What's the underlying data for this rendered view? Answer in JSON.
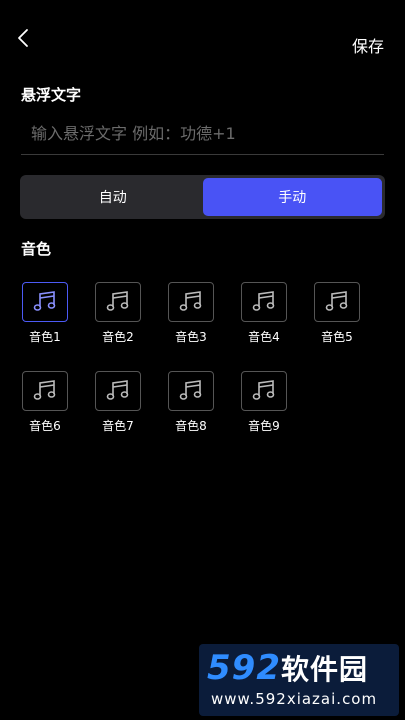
{
  "header": {
    "save_label": "保存"
  },
  "float_text": {
    "title": "悬浮文字",
    "placeholder": "输入悬浮文字 例如：功德+1",
    "value": ""
  },
  "mode": {
    "options": [
      "自动",
      "手动"
    ],
    "selected": "手动"
  },
  "tones": {
    "title": "音色",
    "items": [
      "音色1",
      "音色2",
      "音色3",
      "音色4",
      "音色5",
      "音色6",
      "音色7",
      "音色8",
      "音色9"
    ],
    "selected": "音色1"
  },
  "watermark": {
    "logo_number": "592",
    "logo_text": "软件园",
    "url": "www.592xiazai.com"
  },
  "colors": {
    "background": "#000000",
    "accent": "#4953f5",
    "toggle_bg": "#2a2a2e",
    "tile_border": "#555555",
    "placeholder": "#6b6b6b"
  }
}
